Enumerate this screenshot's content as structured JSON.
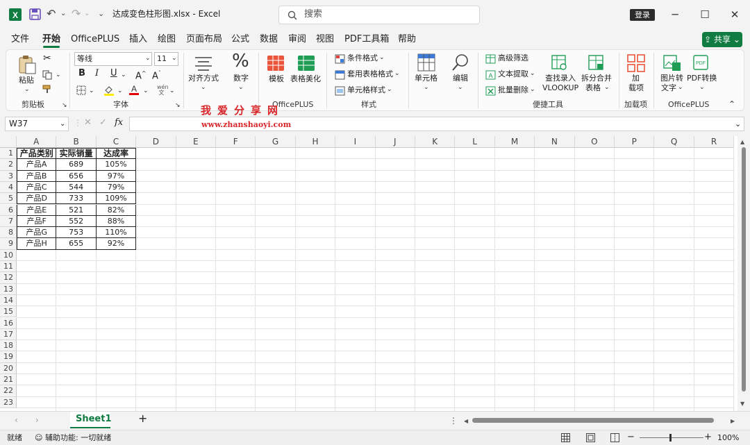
{
  "window": {
    "title": "达成变色柱形图.xlsx  -  Excel",
    "search_placeholder": "搜索",
    "login": "登录",
    "min": "─",
    "max": "☐",
    "close": "✕"
  },
  "tabs": [
    "文件",
    "开始",
    "OfficePLUS",
    "插入",
    "绘图",
    "页面布局",
    "公式",
    "数据",
    "审阅",
    "视图",
    "PDF工具箱",
    "帮助"
  ],
  "share": "共享",
  "ribbon": {
    "paste": "粘贴",
    "clipboard": "剪贴板",
    "font_name": "等线",
    "font_size": "11",
    "font_group": "字体",
    "align": "对齐方式",
    "number": "数字",
    "number_symbol": "%",
    "template": "模板",
    "beautify": "表格美化",
    "officeplus_group": "OfficePLUS",
    "cond_format": "条件格式",
    "table_format": "套用表格格式",
    "cell_style": "单元格样式",
    "styles_group": "样式",
    "cells": "单元格",
    "edit": "编辑",
    "adv_filter": "高级筛选",
    "text_extract": "文本提取",
    "batch_delete": "批量删除",
    "lookup1": "查找录入",
    "lookup2": "VLOOKUP",
    "split1": "拆分合并",
    "split2": "表格",
    "tools_group": "便捷工具",
    "addin1": "加",
    "addin2": "载项",
    "addin_group": "加载项",
    "img2text1": "图片转",
    "img2text2": "文字",
    "pdf_convert": "PDF转换",
    "officeplus_group2": "OfficePLUS"
  },
  "namebox": "W37",
  "fx_label": "fx",
  "watermark": {
    "line1": "我爱分享网",
    "line2": "www.zhanshaoyi.com"
  },
  "columns": [
    "A",
    "B",
    "C",
    "D",
    "E",
    "F",
    "G",
    "H",
    "I",
    "J",
    "K",
    "L",
    "M",
    "N",
    "O",
    "P",
    "Q",
    "R"
  ],
  "rows": [
    "1",
    "2",
    "3",
    "4",
    "5",
    "6",
    "7",
    "8",
    "9",
    "10",
    "11",
    "12",
    "13",
    "14",
    "15",
    "16",
    "17",
    "18",
    "19",
    "20",
    "21",
    "22",
    "23"
  ],
  "table": {
    "headers": [
      "产品类别",
      "实际销量",
      "达成率"
    ],
    "rows": [
      [
        "产品A",
        "689",
        "105%"
      ],
      [
        "产品B",
        "656",
        "97%"
      ],
      [
        "产品C",
        "544",
        "79%"
      ],
      [
        "产品D",
        "733",
        "109%"
      ],
      [
        "产品E",
        "521",
        "82%"
      ],
      [
        "产品F",
        "552",
        "88%"
      ],
      [
        "产品G",
        "753",
        "110%"
      ],
      [
        "产品H",
        "655",
        "92%"
      ]
    ]
  },
  "sheet_tab": "Sheet1",
  "add_sheet": "+",
  "status": {
    "ready": "就绪",
    "accessibility": "辅助功能: 一切就绪",
    "zoom": "100%"
  },
  "colors": {
    "accent": "#107c41",
    "watermark": "#d8262a"
  }
}
